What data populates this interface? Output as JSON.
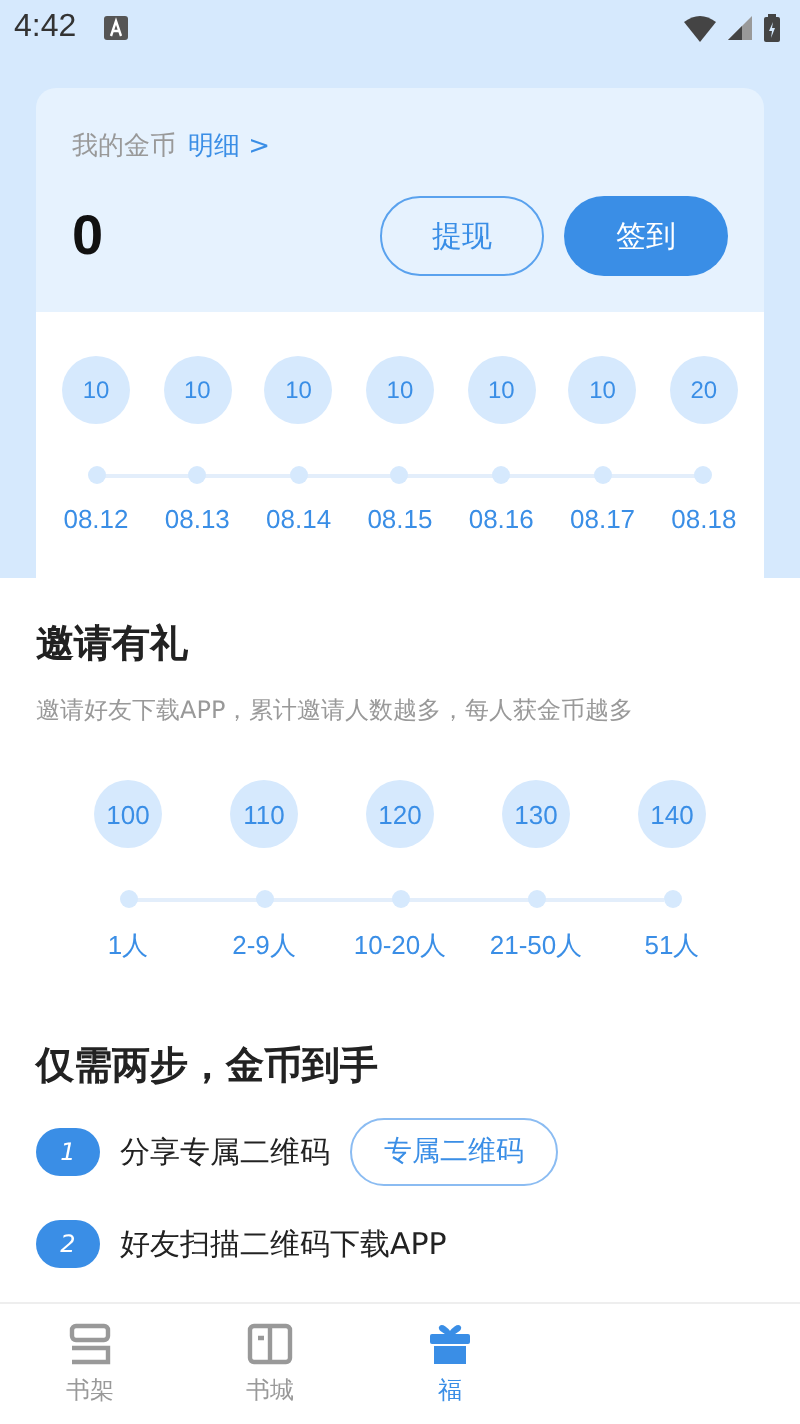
{
  "status_bar": {
    "time": "4:42"
  },
  "coins": {
    "label": "我的金币",
    "detail_link": "明细 >",
    "amount": "0",
    "buttons": [
      {
        "label": "提现",
        "kind": "outline"
      },
      {
        "label": "签到",
        "kind": "filled"
      }
    ]
  },
  "checkin": [
    {
      "coins": "10",
      "date": "08.12"
    },
    {
      "coins": "10",
      "date": "08.13"
    },
    {
      "coins": "10",
      "date": "08.14"
    },
    {
      "coins": "10",
      "date": "08.15"
    },
    {
      "coins": "10",
      "date": "08.16"
    },
    {
      "coins": "10",
      "date": "08.17"
    },
    {
      "coins": "20",
      "date": "08.18"
    }
  ],
  "invite": {
    "title": "邀请有礼",
    "subtitle": "邀请好友下载APP，累计邀请人数越多，每人获金币越多",
    "tiers": [
      {
        "coins": "100",
        "people": "1人"
      },
      {
        "coins": "110",
        "people": "2-9人"
      },
      {
        "coins": "120",
        "people": "10-20人"
      },
      {
        "coins": "130",
        "people": "21-50人"
      },
      {
        "coins": "140",
        "people": "51人"
      }
    ]
  },
  "steps": {
    "title": "仅需两步，金币到手",
    "items": [
      {
        "number": "1",
        "text": "分享专属二维码",
        "button": "专属二维码"
      },
      {
        "number": "2",
        "text": "好友扫描二维码下载APP"
      }
    ]
  },
  "tab_bar": [
    {
      "label": "书架",
      "kind": "shelf",
      "selected": false
    },
    {
      "label": "书城",
      "kind": "book",
      "selected": false
    },
    {
      "label": "福",
      "kind": "gift",
      "selected": true
    }
  ]
}
